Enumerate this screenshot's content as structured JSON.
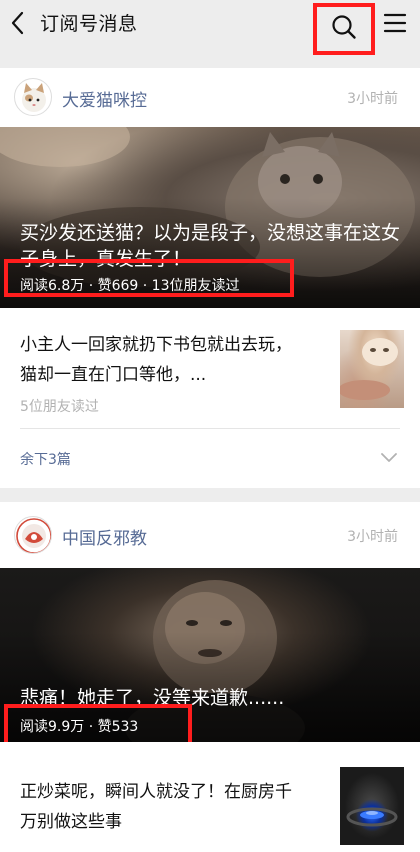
{
  "header": {
    "title": "订阅号消息"
  },
  "cards": [
    {
      "source": "大爱猫咪控",
      "time": "3小时前",
      "hero_title": "买沙发还送猫？以为是段子，没想这事在这女子身上，真发生了！",
      "hero_stats": "阅读6.8万 · 赞669 · 13位朋友读过",
      "item_title": "小主人一回家就扔下书包就出去玩，猫却一直在门口等他，...",
      "item_sub": "5位朋友读过",
      "more": "余下3篇"
    },
    {
      "source": "中国反邪教",
      "time": "3小时前",
      "hero_title": "悲痛！她走了，没等来道歉......",
      "hero_stats": "阅读9.9万 · 赞533",
      "item_title": "正炒菜呢，瞬间人就没了！在厨房千万别做这些事"
    }
  ],
  "colors": {
    "highlight_box": "#ff1d1d",
    "link_blue": "#576b95",
    "muted_gray": "#b2b2b2"
  },
  "icons": [
    "back-arrow-icon",
    "search-icon",
    "menu-icon",
    "chevron-down-icon"
  ]
}
